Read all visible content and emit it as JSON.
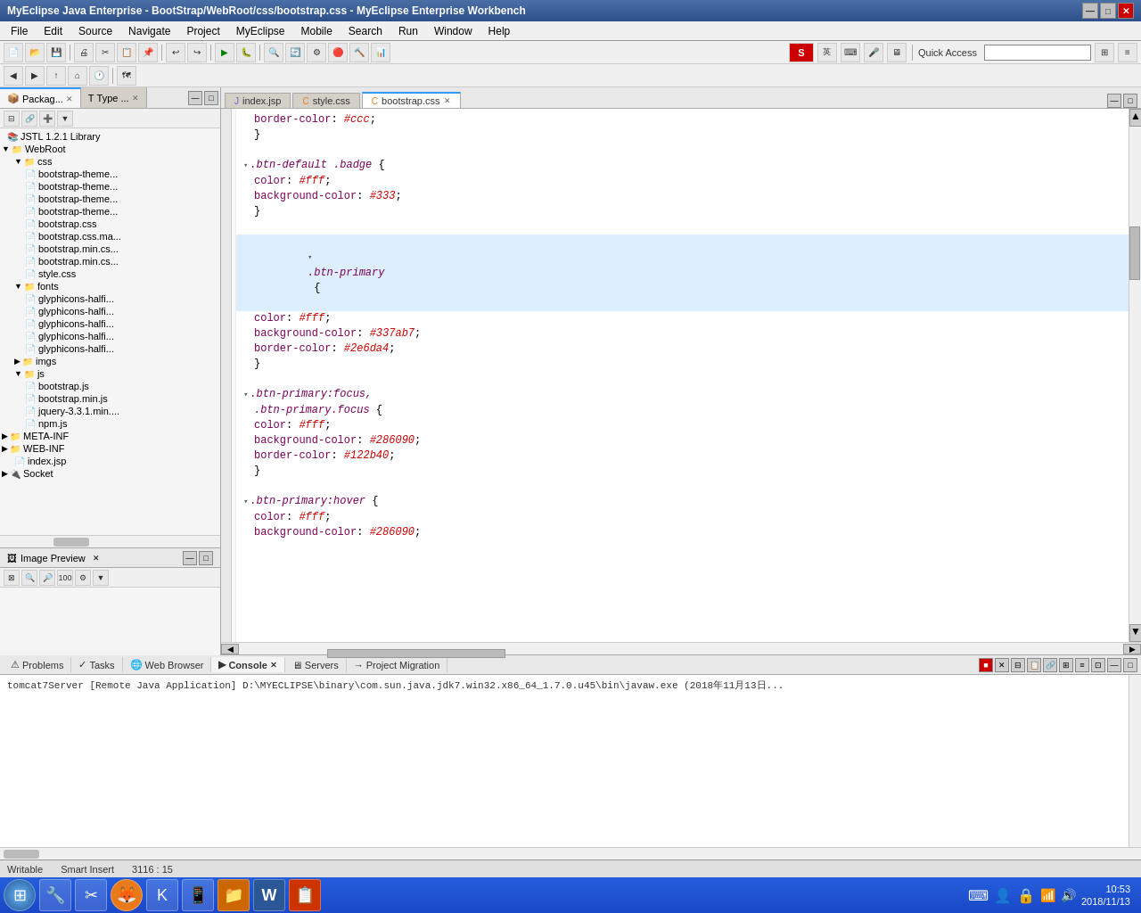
{
  "titlebar": {
    "title": "MyEclipse Java Enterprise - BootStrap/WebRoot/css/bootstrap.css - MyEclipse Enterprise Workbench",
    "min_label": "—",
    "max_label": "□",
    "close_label": "✕"
  },
  "menubar": {
    "items": [
      "File",
      "Edit",
      "Source",
      "Navigate",
      "Project",
      "MyEclipse",
      "Mobile",
      "Search",
      "Run",
      "Window",
      "Help"
    ]
  },
  "quick_access": {
    "label": "Quick Access"
  },
  "editor": {
    "tabs": [
      {
        "label": "index.jsp",
        "icon": "jsp",
        "active": false
      },
      {
        "label": "style.css",
        "icon": "css",
        "active": false
      },
      {
        "label": "bootstrap.css",
        "icon": "css",
        "active": true
      }
    ]
  },
  "code_lines": [
    {
      "indent": "      ",
      "content": "border-color: #ccc;",
      "type": "property-hex"
    },
    {
      "indent": "   ",
      "content": "}",
      "type": "brace"
    },
    {
      "indent": "",
      "content": "",
      "type": "empty"
    },
    {
      "indent": "   ",
      "content": ".btn-default .badge {",
      "type": "selector",
      "fold": true
    },
    {
      "indent": "      ",
      "content": "color: #fff;",
      "type": "property-hex"
    },
    {
      "indent": "      ",
      "content": "background-color: #333;",
      "type": "property-hex"
    },
    {
      "indent": "   ",
      "content": "}",
      "type": "brace"
    },
    {
      "indent": "",
      "content": "",
      "type": "empty"
    },
    {
      "indent": "   ",
      "content": ".btn-primary {",
      "type": "selector",
      "fold": true,
      "highlight": true
    },
    {
      "indent": "      ",
      "content": "color: #fff;",
      "type": "property-hex",
      "highlight": true
    },
    {
      "indent": "      ",
      "content": "background-color: #337ab7;",
      "type": "property-hex",
      "highlight": true
    },
    {
      "indent": "      ",
      "content": "border-color: #2e6da4;",
      "type": "property-hex",
      "highlight": true
    },
    {
      "indent": "   ",
      "content": "}",
      "type": "brace",
      "highlight": true
    },
    {
      "indent": "",
      "content": "",
      "type": "empty"
    },
    {
      "indent": "   ",
      "content": ".btn-primary:focus,",
      "type": "selector",
      "fold": true
    },
    {
      "indent": "   ",
      "content": ".btn-primary.focus {",
      "type": "selector"
    },
    {
      "indent": "      ",
      "content": "color: #fff;",
      "type": "property-hex"
    },
    {
      "indent": "      ",
      "content": "background-color: #286090;",
      "type": "property-hex"
    },
    {
      "indent": "      ",
      "content": "border-color: #122b40;",
      "type": "property-hex"
    },
    {
      "indent": "   ",
      "content": "}",
      "type": "brace"
    },
    {
      "indent": "",
      "content": "",
      "type": "empty"
    },
    {
      "indent": "   ",
      "content": ".btn-primary:hover {",
      "type": "selector",
      "fold": true
    },
    {
      "indent": "      ",
      "content": "color: #fff;",
      "type": "property-hex"
    },
    {
      "indent": "      ",
      "content": "background-color: #286090;",
      "type": "property-hex"
    }
  ],
  "tree": {
    "items": [
      {
        "label": "JSTL 1.2.1 Library",
        "level": 1,
        "icon": "📚",
        "type": "library"
      },
      {
        "label": "WebRoot",
        "level": 1,
        "icon": "📁",
        "type": "folder",
        "open": true
      },
      {
        "label": "css",
        "level": 2,
        "icon": "📁",
        "type": "folder",
        "open": true
      },
      {
        "label": "bootstrap-them...",
        "level": 3,
        "icon": "📄",
        "type": "file"
      },
      {
        "label": "bootstrap-them...",
        "level": 3,
        "icon": "📄",
        "type": "file"
      },
      {
        "label": "bootstrap-them...",
        "level": 3,
        "icon": "📄",
        "type": "file"
      },
      {
        "label": "bootstrap-them...",
        "level": 3,
        "icon": "📄",
        "type": "file"
      },
      {
        "label": "bootstrap.css",
        "level": 3,
        "icon": "📄",
        "type": "file"
      },
      {
        "label": "bootstrap.css.ma...",
        "level": 3,
        "icon": "📄",
        "type": "file"
      },
      {
        "label": "bootstrap.min.cs...",
        "level": 3,
        "icon": "📄",
        "type": "file"
      },
      {
        "label": "bootstrap.min.cs...",
        "level": 3,
        "icon": "📄",
        "type": "file"
      },
      {
        "label": "style.css",
        "level": 3,
        "icon": "📄",
        "type": "file"
      },
      {
        "label": "fonts",
        "level": 2,
        "icon": "📁",
        "type": "folder",
        "open": true
      },
      {
        "label": "glyphicons-halfi...",
        "level": 3,
        "icon": "📄",
        "type": "file"
      },
      {
        "label": "glyphicons-halfi...",
        "level": 3,
        "icon": "📄",
        "type": "file"
      },
      {
        "label": "glyphicons-halfi...",
        "level": 3,
        "icon": "📄",
        "type": "file"
      },
      {
        "label": "glyphicons-halfi...",
        "level": 3,
        "icon": "📄",
        "type": "file"
      },
      {
        "label": "glyphicons-halfi...",
        "level": 3,
        "icon": "📄",
        "type": "file"
      },
      {
        "label": "imgs",
        "level": 2,
        "icon": "📁",
        "type": "folder"
      },
      {
        "label": "js",
        "level": 2,
        "icon": "📁",
        "type": "folder",
        "open": true
      },
      {
        "label": "bootstrap.js",
        "level": 3,
        "icon": "📄",
        "type": "file"
      },
      {
        "label": "bootstrap.min.js",
        "level": 3,
        "icon": "📄",
        "type": "file"
      },
      {
        "label": "jquery-3.3.1.min....",
        "level": 3,
        "icon": "📄",
        "type": "file"
      },
      {
        "label": "npm.js",
        "level": 3,
        "icon": "📄",
        "type": "file"
      },
      {
        "label": "META-INF",
        "level": 1,
        "icon": "📁",
        "type": "folder"
      },
      {
        "label": "WEB-INF",
        "level": 1,
        "icon": "📁",
        "type": "folder"
      },
      {
        "label": "index.jsp",
        "level": 2,
        "icon": "📄",
        "type": "file"
      },
      {
        "label": "Socket",
        "level": 0,
        "icon": "🔌",
        "type": "item"
      }
    ]
  },
  "left_panel": {
    "tabs": [
      {
        "label": "Packag...",
        "active": true
      },
      {
        "label": "Type ...",
        "active": false
      }
    ]
  },
  "bottom": {
    "tabs": [
      {
        "label": "Problems",
        "active": false,
        "icon": "⚠"
      },
      {
        "label": "Tasks",
        "active": false,
        "icon": "✓"
      },
      {
        "label": "Web Browser",
        "active": false,
        "icon": "🌐"
      },
      {
        "label": "Console",
        "active": true,
        "icon": "▶",
        "closeable": true
      },
      {
        "label": "Servers",
        "active": false,
        "icon": "🖥"
      },
      {
        "label": "Project Migration",
        "active": false,
        "icon": "→"
      }
    ],
    "console_line": "tomcat7Server [Remote Java Application] D:\\MYECLIPSE\\binary\\com.sun.java.jdk7.win32.x86_64_1.7.0.u45\\bin\\javaw.exe (2018年11月13日..."
  },
  "statusbar": {
    "writable": "Writable",
    "insert_mode": "Smart Insert",
    "position": "3116 : 15"
  },
  "taskbar": {
    "buttons": [
      "⊞",
      "🔧",
      "✂",
      "🦊",
      "K",
      "📱",
      "📁",
      "W",
      "📋"
    ],
    "time": "10:53",
    "date": "2018/11/13"
  },
  "image_preview": {
    "label": "Image Preview"
  }
}
